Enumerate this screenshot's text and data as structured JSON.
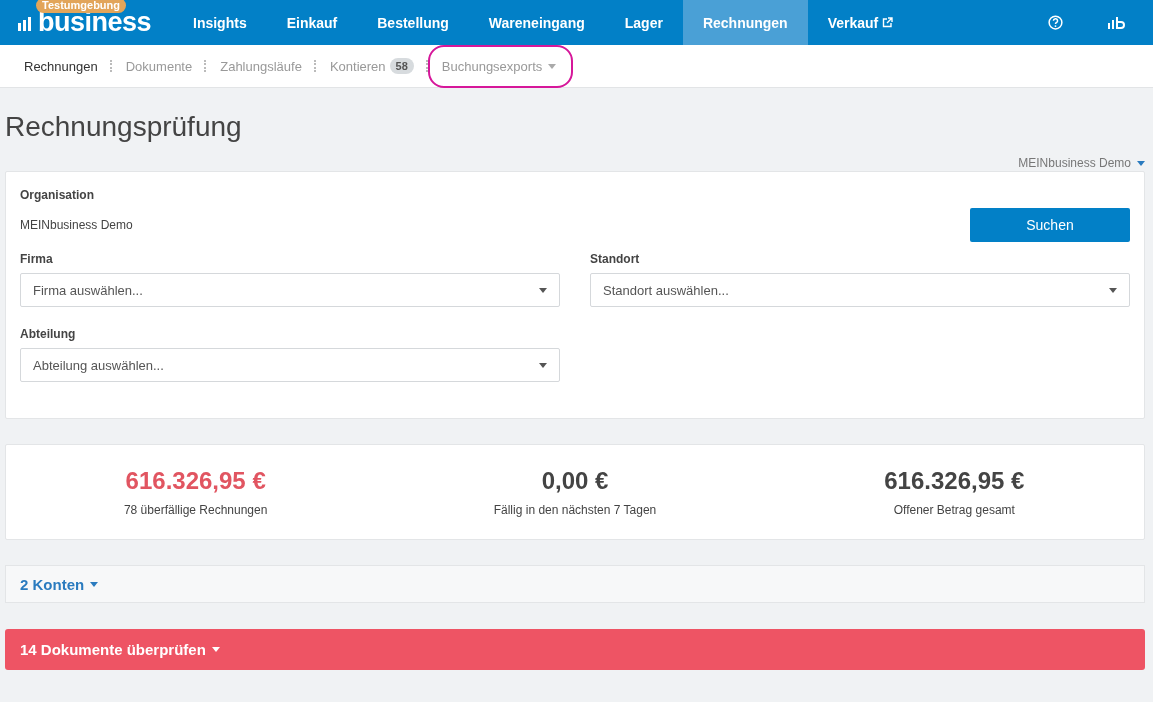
{
  "brand": {
    "logo_text": "business",
    "badge": "Testumgebung"
  },
  "nav": [
    {
      "label": "Insights",
      "selected": false,
      "external": false
    },
    {
      "label": "Einkauf",
      "selected": false,
      "external": false
    },
    {
      "label": "Bestellung",
      "selected": false,
      "external": false
    },
    {
      "label": "Wareneingang",
      "selected": false,
      "external": false
    },
    {
      "label": "Lager",
      "selected": false,
      "external": false
    },
    {
      "label": "Rechnungen",
      "selected": true,
      "external": false
    },
    {
      "label": "Verkauf",
      "selected": false,
      "external": true
    }
  ],
  "subnav": [
    {
      "label": "Rechnungen",
      "selected": true
    },
    {
      "label": "Dokumente",
      "selected": false
    },
    {
      "label": "Zahlungsläufe",
      "selected": false
    },
    {
      "label": "Kontieren",
      "selected": false,
      "count": "58"
    },
    {
      "label": "Buchungsexports",
      "selected": false,
      "dropdown": true,
      "highlighted": true
    }
  ],
  "page_title": "Rechnungsprüfung",
  "org_switcher": "MEINbusiness Demo",
  "filters": {
    "organisation_label": "Organisation",
    "organisation_value": "MEINbusiness Demo",
    "search_button": "Suchen",
    "selects": [
      {
        "label": "Firma",
        "placeholder": "Firma auswählen..."
      },
      {
        "label": "Standort",
        "placeholder": "Standort auswählen..."
      },
      {
        "label": "Abteilung",
        "placeholder": "Abteilung auswählen..."
      }
    ]
  },
  "stats": [
    {
      "value": "616.326,95 €",
      "caption": "78 überfällige Rechnungen",
      "kind": "alert"
    },
    {
      "value": "0,00 €",
      "caption": "Fällig in den nächsten 7 Tagen",
      "kind": "normal"
    },
    {
      "value": "616.326,95 €",
      "caption": "Offener Betrag gesamt",
      "kind": "normal"
    }
  ],
  "accounts_toggle": "2 Konten",
  "review_toggle": "14 Dokumente überprüfen"
}
